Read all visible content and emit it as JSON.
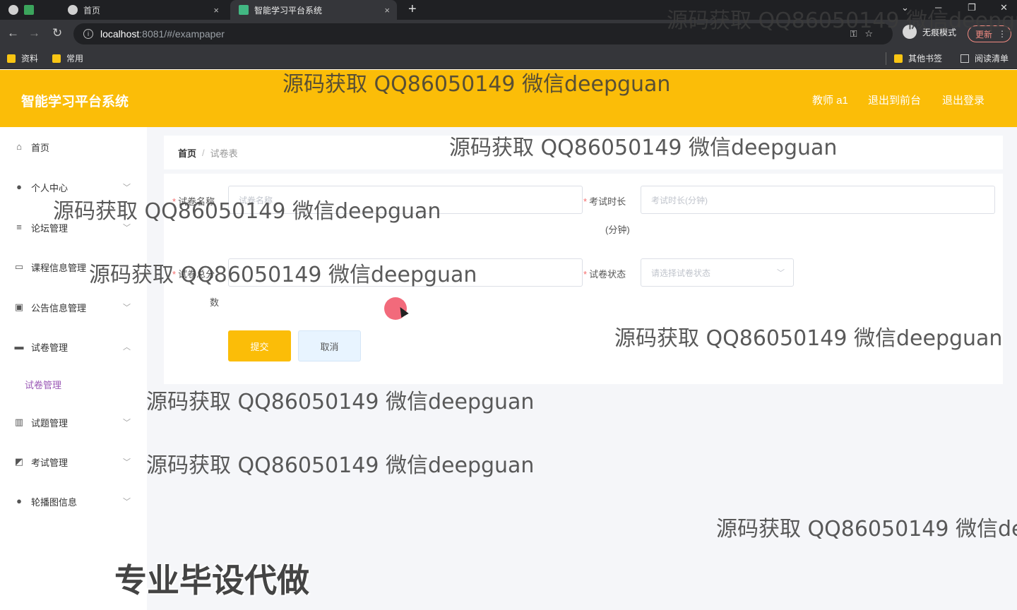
{
  "browser": {
    "tabs": [
      {
        "title": "首页",
        "close": "×"
      },
      {
        "title": "智能学习平台系统",
        "close": "×"
      }
    ],
    "new_tab": "+",
    "url_host": "localhost",
    "url_path": ":8081/#/exampaper",
    "incognito_label": "无痕模式",
    "update_label": "更新",
    "bookmarks": [
      "资料",
      "常用"
    ],
    "other_bookmarks": "其他书签",
    "reading_list": "阅读清单"
  },
  "header": {
    "title": "智能学习平台系统",
    "user": "教师 a1",
    "to_front": "退出到前台",
    "logout": "退出登录"
  },
  "sidebar": {
    "items": [
      {
        "label": "首页",
        "icon": "home-icon"
      },
      {
        "label": "个人中心",
        "icon": "user-icon"
      },
      {
        "label": "论坛管理",
        "icon": "sliders-icon"
      },
      {
        "label": "课程信息管理",
        "icon": "card-icon"
      },
      {
        "label": "公告信息管理",
        "icon": "clipboard-icon"
      },
      {
        "label": "试卷管理",
        "icon": "folder-icon"
      },
      {
        "label": "试题管理",
        "icon": "bar-chart-icon"
      },
      {
        "label": "考试管理",
        "icon": "line-chart-icon"
      },
      {
        "label": "轮播图信息",
        "icon": "user-icon"
      }
    ],
    "submenu": "试卷管理"
  },
  "breadcrumb": {
    "home": "首页",
    "sep": "/",
    "current": "试卷表"
  },
  "form": {
    "name_label": "试卷名称",
    "name_placeholder": "试卷名称",
    "duration_label": "考试时长",
    "duration_unit": "(分钟)",
    "duration_placeholder": "考试时长(分钟)",
    "total_label": "试卷总分",
    "total_suffix": "数",
    "status_label": "试卷状态",
    "status_placeholder": "请选择试卷状态",
    "submit": "提交",
    "cancel": "取消"
  },
  "watermark": "源码获取 QQ86050149 微信deepguan",
  "promo": "专业毕设代做",
  "colors": {
    "accent": "#fbbd08",
    "submenu": "#9b59b6"
  }
}
